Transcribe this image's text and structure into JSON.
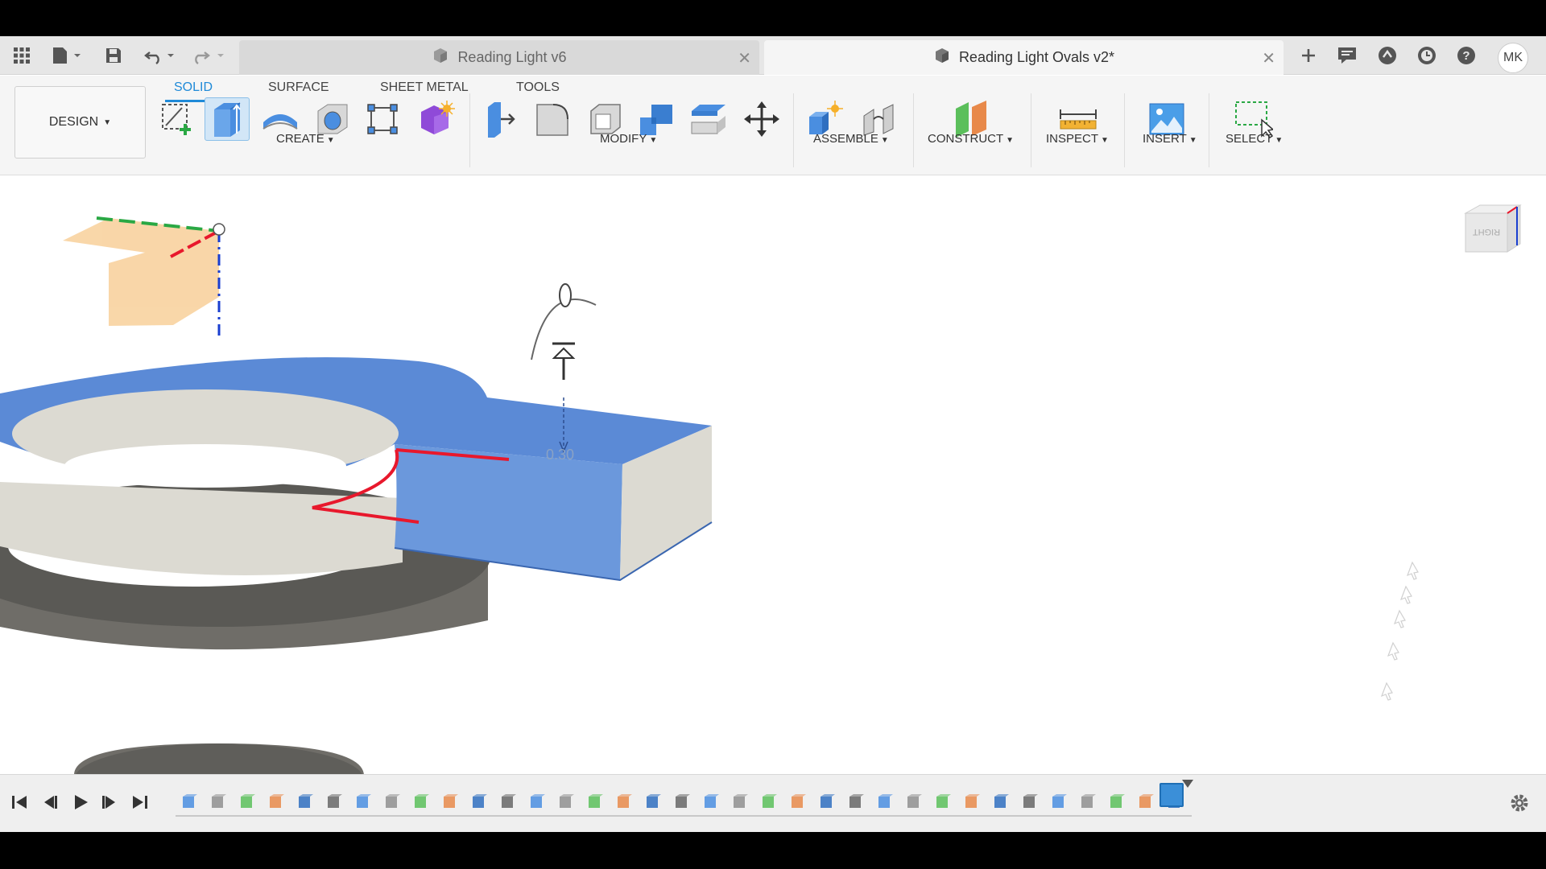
{
  "app": {
    "title_bar": {
      "tabs": [
        {
          "label": "Reading Light v6",
          "active": false
        },
        {
          "label": "Reading Light Ovals v2*",
          "active": true
        }
      ],
      "user_initials": "MK"
    },
    "toolbar": {
      "workspace_button": "DESIGN",
      "workspace_tabs": [
        {
          "label": "SOLID",
          "active": true
        },
        {
          "label": "SURFACE",
          "active": false
        },
        {
          "label": "SHEET METAL",
          "active": false
        },
        {
          "label": "TOOLS",
          "active": false
        }
      ],
      "groups": {
        "create": "CREATE",
        "modify": "MODIFY",
        "assemble": "ASSEMBLE",
        "construct": "CONSTRUCT",
        "inspect": "INSPECT",
        "insert": "INSERT",
        "select": "SELECT"
      }
    },
    "viewport": {
      "dimension_value": "0.30",
      "viewcube_face": "RIGHT"
    },
    "colors": {
      "accent": "#1f8ad8",
      "body_blue": "#5b8ad6",
      "body_grey": "#dcdad2",
      "dark_grey": "#6f6d68",
      "selection_red": "#e8182c",
      "sketch_orange": "#f7c98c"
    }
  }
}
